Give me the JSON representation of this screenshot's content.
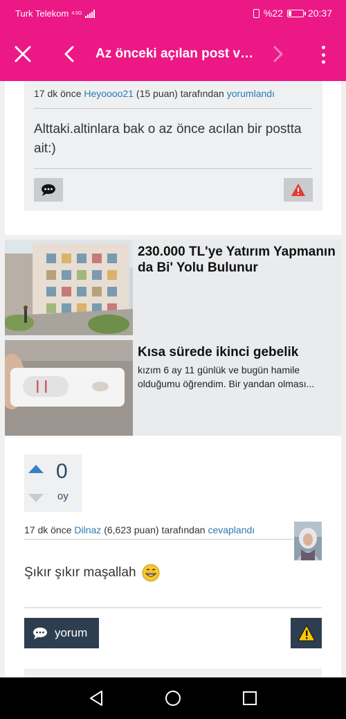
{
  "status_bar": {
    "carrier": "Turk Telekom",
    "network": "4.5G",
    "battery_percent": "%22",
    "battery_level": 0.22,
    "time": "20:37"
  },
  "app_bar": {
    "close_icon": "close-icon",
    "back_icon": "chevron-left-icon",
    "title": "Az önceki açılan post ve...",
    "forward_icon": "chevron-right-icon",
    "more_icon": "more-vertical-icon"
  },
  "comment": {
    "time": "17 dk önce",
    "author": "Heyoooo21",
    "points": "(15 puan)",
    "by": "tarafından",
    "action": "yorumlandı",
    "text": "Alttaki.altinlara bak o az önce acılan bir postta ait:)"
  },
  "ads": [
    {
      "title": "230.000 TL'ye Yatırım Yapmanın da Bi' Yolu Bulunur",
      "description": ""
    },
    {
      "title": "Kısa sürede ikinci gebelik",
      "description": "kızım 6 ay 11 günlük ve bugün hamile olduğumu öğrendim. Bir yandan olması..."
    }
  ],
  "answer": {
    "votes": "0",
    "vote_label": "oy",
    "time": "17 dk önce",
    "author": "Dilnaz",
    "points": "(6,623 puan)",
    "by": "tarafından",
    "action": "cevaplandı",
    "text": "Şıkır şıkır maşallah",
    "yorum_label": "yorum"
  },
  "colors": {
    "brand": "#ec1886",
    "link": "#2a7ab0",
    "dark_button": "#2c3e50",
    "vote_up": "#3a7fc4",
    "warn_red": "#e53935",
    "warn_yellow": "#f9c802"
  }
}
